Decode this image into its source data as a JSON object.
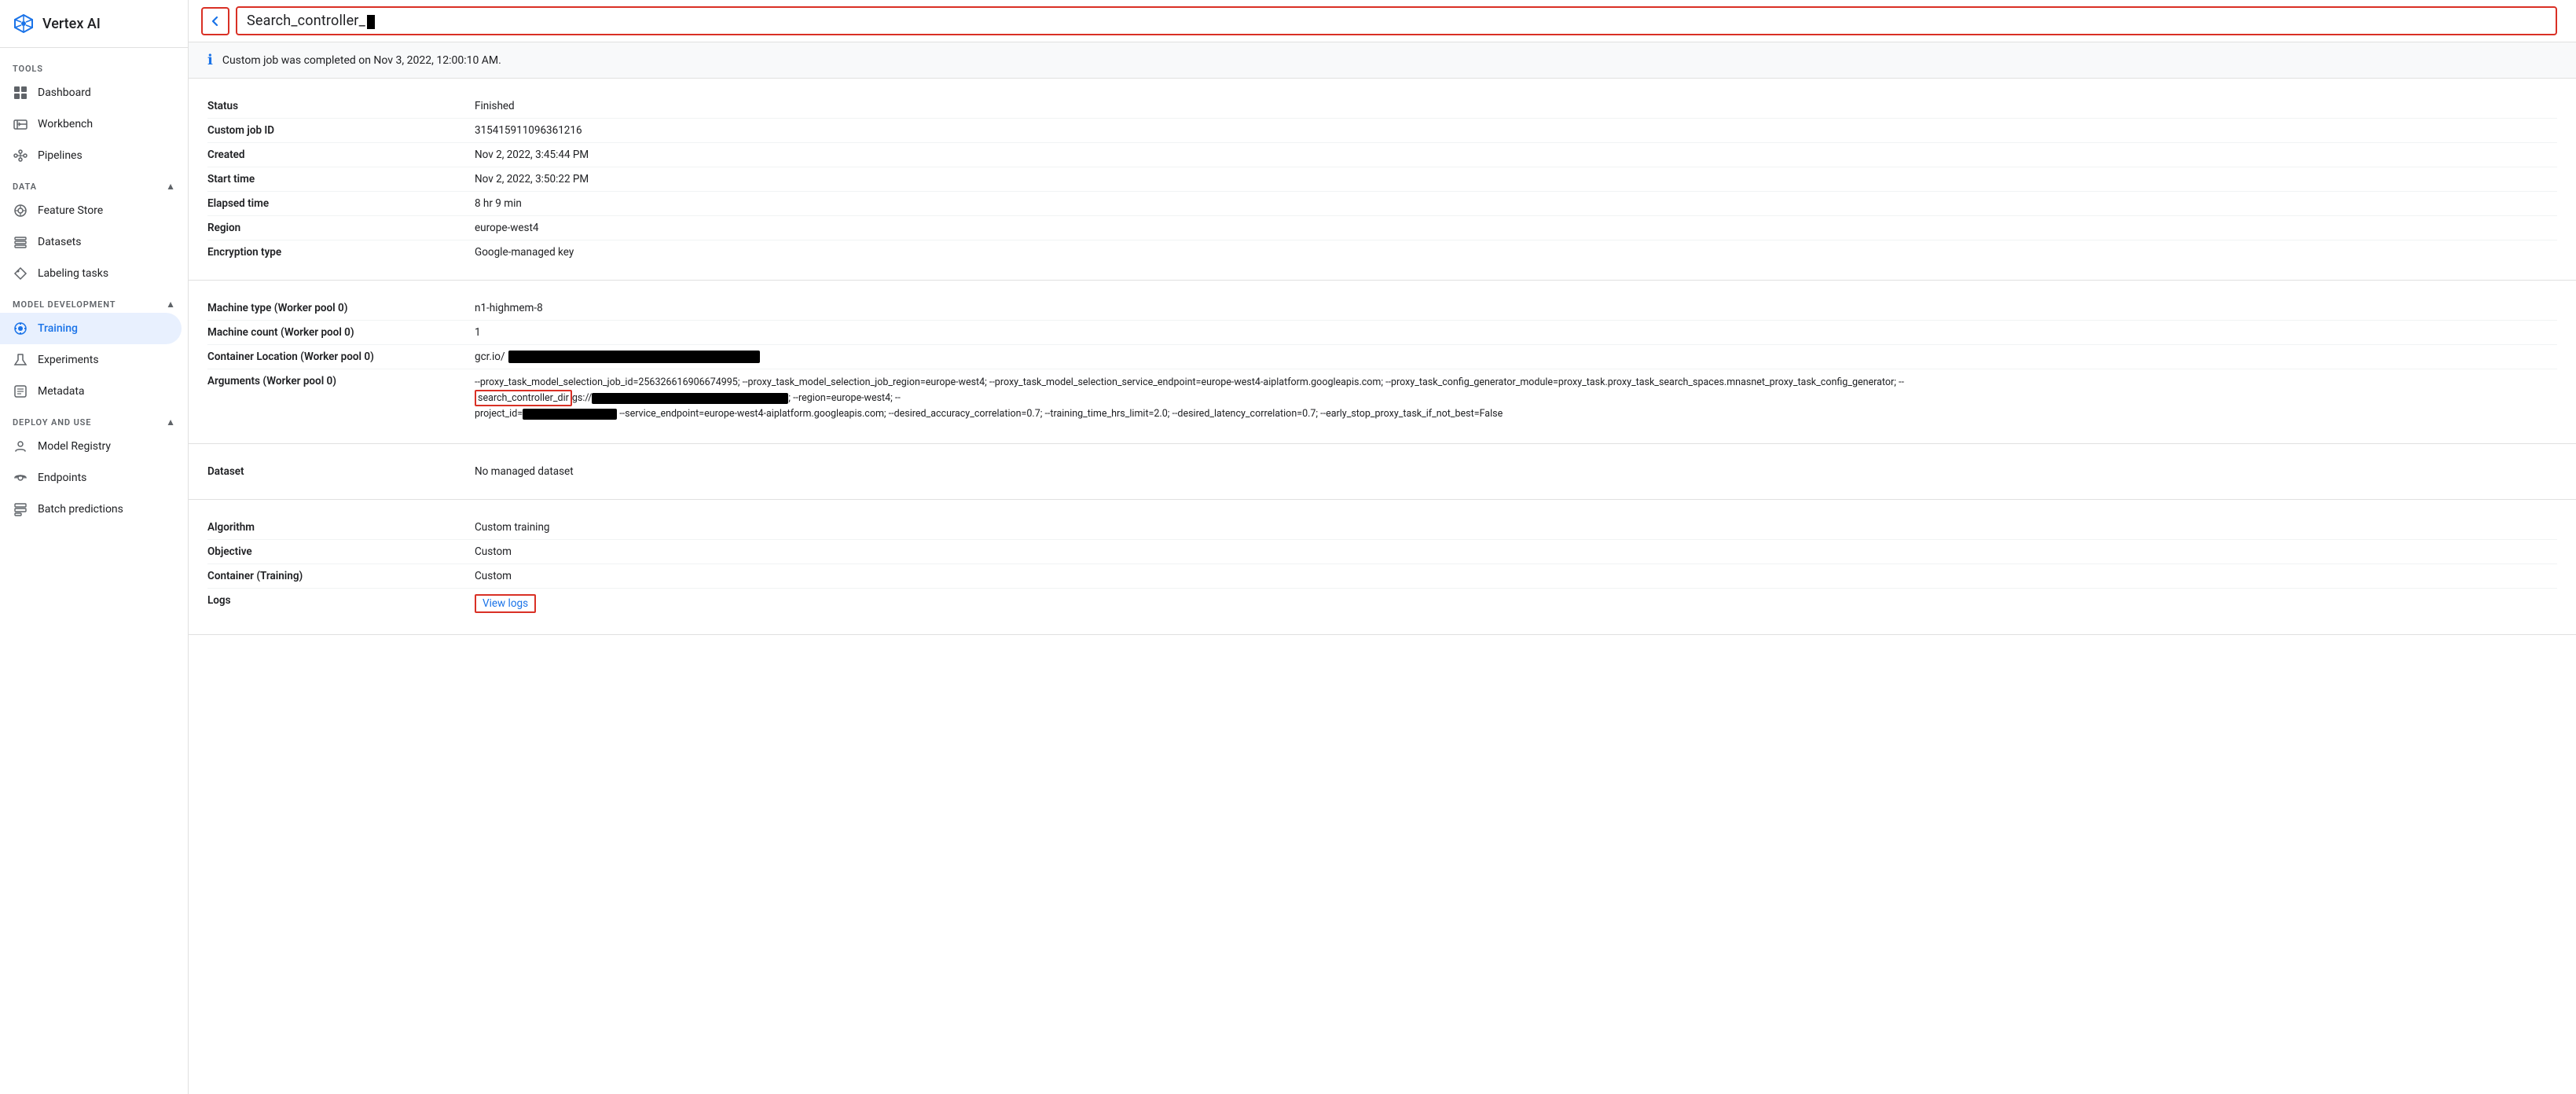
{
  "app": {
    "title": "Vertex AI"
  },
  "sidebar": {
    "tools_label": "TOOLS",
    "data_label": "DATA",
    "model_dev_label": "MODEL DEVELOPMENT",
    "deploy_label": "DEPLOY AND USE",
    "items": {
      "dashboard": "Dashboard",
      "workbench": "Workbench",
      "pipelines": "Pipelines",
      "feature_store": "Feature Store",
      "datasets": "Datasets",
      "labeling_tasks": "Labeling tasks",
      "training": "Training",
      "experiments": "Experiments",
      "metadata": "Metadata",
      "model_registry": "Model Registry",
      "endpoints": "Endpoints",
      "batch_predictions": "Batch predictions"
    }
  },
  "header": {
    "title_prefix": "Search_controller_",
    "back_label": "←"
  },
  "info_banner": {
    "text": "Custom job was completed on Nov 3, 2022, 12:00:10 AM."
  },
  "details": {
    "status_label": "Status",
    "status_value": "Finished",
    "job_id_label": "Custom job ID",
    "job_id_value": "315415911096361216",
    "created_label": "Created",
    "created_value": "Nov 2, 2022, 3:45:44 PM",
    "start_time_label": "Start time",
    "start_time_value": "Nov 2, 2022, 3:50:22 PM",
    "elapsed_label": "Elapsed time",
    "elapsed_value": "8 hr 9 min",
    "region_label": "Region",
    "region_value": "europe-west4",
    "encryption_label": "Encryption type",
    "encryption_value": "Google-managed key",
    "machine_type_label": "Machine type (Worker pool 0)",
    "machine_type_value": "n1-highmem-8",
    "machine_count_label": "Machine count (Worker pool 0)",
    "machine_count_value": "1",
    "container_loc_label": "Container Location (Worker pool 0)",
    "container_loc_prefix": "gcr.io/",
    "arguments_label": "Arguments (Worker pool 0)",
    "arguments_line1": "--proxy_task_model_selection_job_id=256326616906674995; --proxy_task_model_selection_job_region=europe-west4; --proxy_task_model_selection_service_endpoint=europe-west4-aiplatform.googleapis.com; --proxy_task_config_generator_module=proxy_task.proxy_task_search_spaces.mnasnet_proxy_task_config_generator; --",
    "arguments_highlight": "search_controller_dir",
    "arguments_line2_suffix": "gs://",
    "arguments_line2_end": "; --region=europe-west4; --",
    "arguments_line3": "project_id=",
    "arguments_line3_mid": " --service_endpoint=europe-west4-aiplatform.googleapis.com; --desired_accuracy_correlation=0.7; --training_time_hrs_limit=2.0; --desired_latency_correlation=0.7; --early_stop_proxy_task_if_not_best=False",
    "dataset_label": "Dataset",
    "dataset_value": "No managed dataset",
    "algorithm_label": "Algorithm",
    "algorithm_value": "Custom training",
    "objective_label": "Objective",
    "objective_value": "Custom",
    "container_training_label": "Container (Training)",
    "container_training_value": "Custom",
    "logs_label": "Logs",
    "logs_link_text": "View logs"
  }
}
